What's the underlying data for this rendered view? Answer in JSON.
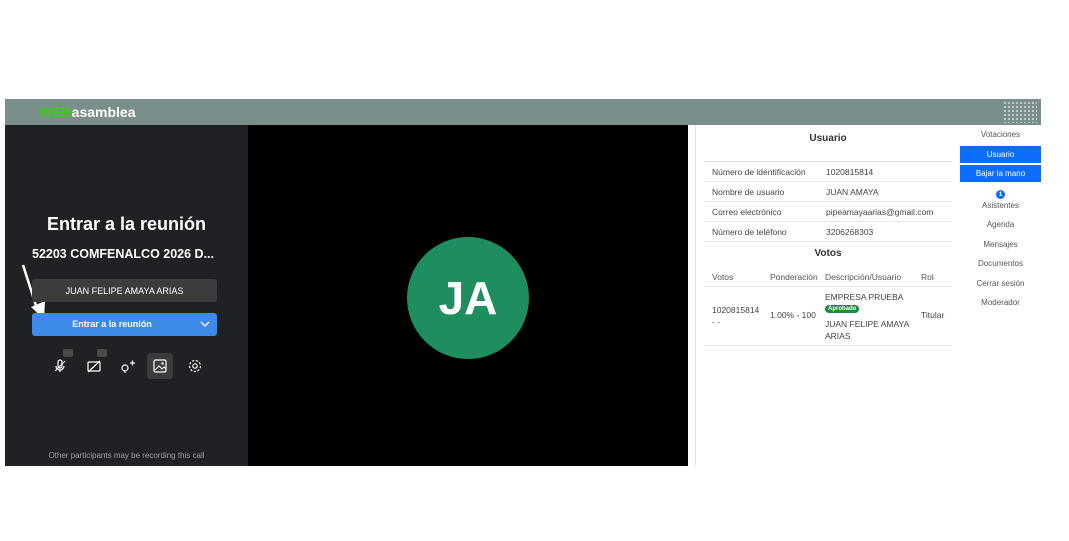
{
  "app": {
    "brand_prefix": "WEB",
    "brand_suffix": "asamblea"
  },
  "prejoin": {
    "title": "Entrar a la reunión",
    "meeting_name": "52203 COMFENALCO 2026 D...",
    "participant_name": "JUAN FELIPE AMAYA ARIAS",
    "join_label": "Entrar a la reunión",
    "footer": "Other participants may be recording this call",
    "icons": [
      "mic-off-icon",
      "camera-off-icon",
      "invite-icon",
      "background-icon",
      "settings-icon"
    ]
  },
  "video": {
    "avatar_initials": "JA",
    "avatar_color": "#1e8e5f"
  },
  "panel": {
    "title": "Usuario",
    "user_info": [
      {
        "label": "Número de identificación",
        "value": "1020815814"
      },
      {
        "label": "Nombre de usuario",
        "value": "JUAN AMAYA"
      },
      {
        "label": "Correo electrónico",
        "value": "pipeamayaarias@gmail.com"
      },
      {
        "label": "Número de teléfono",
        "value": "3206268303"
      }
    ],
    "votes_title": "Votos",
    "votes_headers": [
      "Votos",
      "Ponderación",
      "Descripción/Usuario",
      "Rol"
    ],
    "votes_rows": [
      {
        "votos": "1020815814",
        "votos_sub": "- -",
        "ponderacion": "1.00% - 100",
        "empresa": "EMPRESA PRUEBA",
        "estado": "Aprobado",
        "usuario": "JUAN FELIPE AMAYA ARIAS",
        "rol": "Titular"
      }
    ]
  },
  "sidenav": {
    "items": [
      "Votaciones",
      "Usuario",
      "Bajar la mano",
      "Asistentes",
      "Agenda",
      "Mensajes",
      "Documentos",
      "Cerrar sesión",
      "Moderador"
    ],
    "badge": "1"
  },
  "colors": {
    "topbar": "#7a8f8c",
    "brand_green": "#35d10c",
    "join_blue": "#3d8ae8",
    "nav_active": "#0d6efd",
    "approved": "#1f8a3b"
  }
}
